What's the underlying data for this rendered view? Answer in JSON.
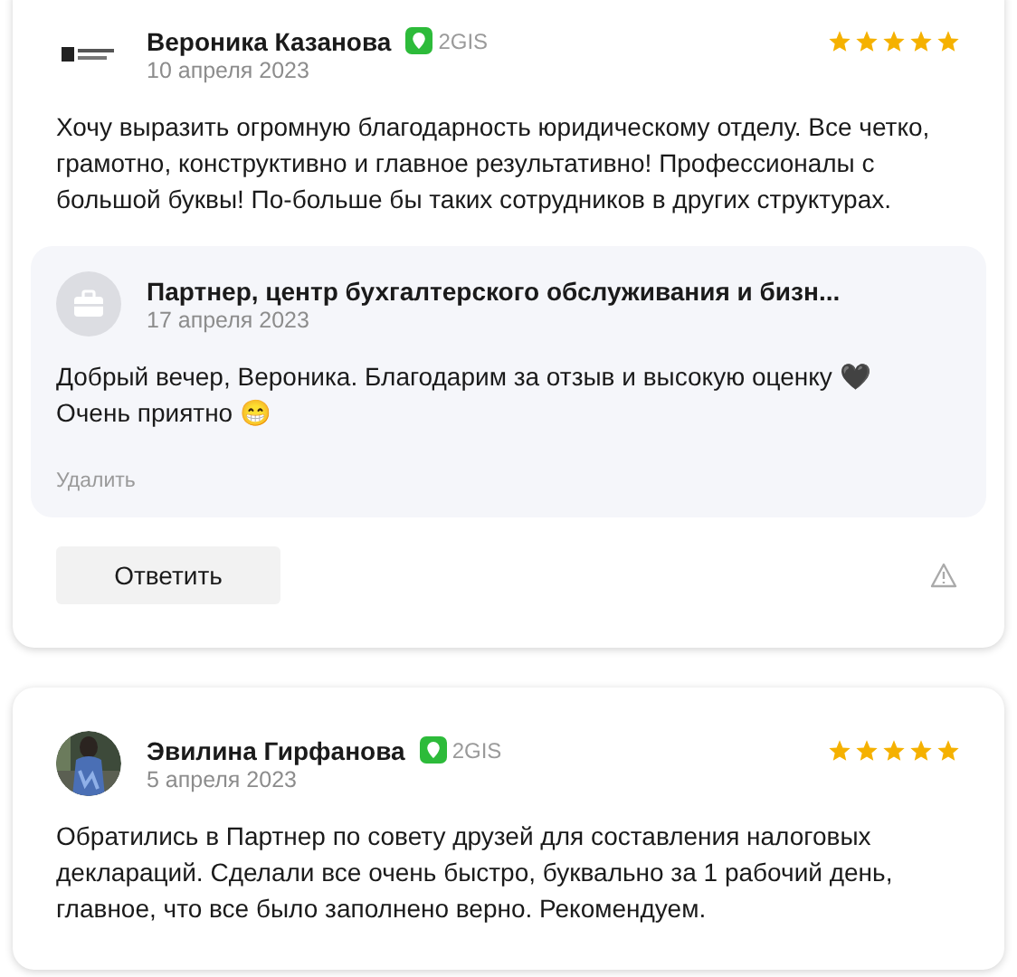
{
  "reviews": [
    {
      "author": "Вероника Казанова",
      "avatar": {
        "kind": "logo"
      },
      "source": "2GIS",
      "date": "10 апреля 2023",
      "stars": 5,
      "text": "Хочу выразить огромную благодарность юридическому отделу. Все четко, грамотно, конструктивно и главное результативно! Профессионалы с большой буквы! По-больше бы таких сотрудников в других структурах.",
      "reply": {
        "author": "Партнер, центр бухгалтерского обслуживания и бизн...",
        "date": "17 апреля 2023",
        "text": "Добрый вечер, Вероника. Благодарим за отзыв и высокую оценку 🖤 Очень приятно 😁",
        "action": "Удалить"
      },
      "reply_button": "Ответить"
    },
    {
      "author": "Эвилина Гирфанова",
      "source": "2GIS",
      "date": "5 апреля 2023",
      "stars": 5,
      "text": "Обратились в Партнер по совету друзей для составления налоговых деклараций. Сделали все очень быстро, буквально за 1 рабочий день, главное, что все было заполнено верно. Рекомендуем."
    }
  ]
}
